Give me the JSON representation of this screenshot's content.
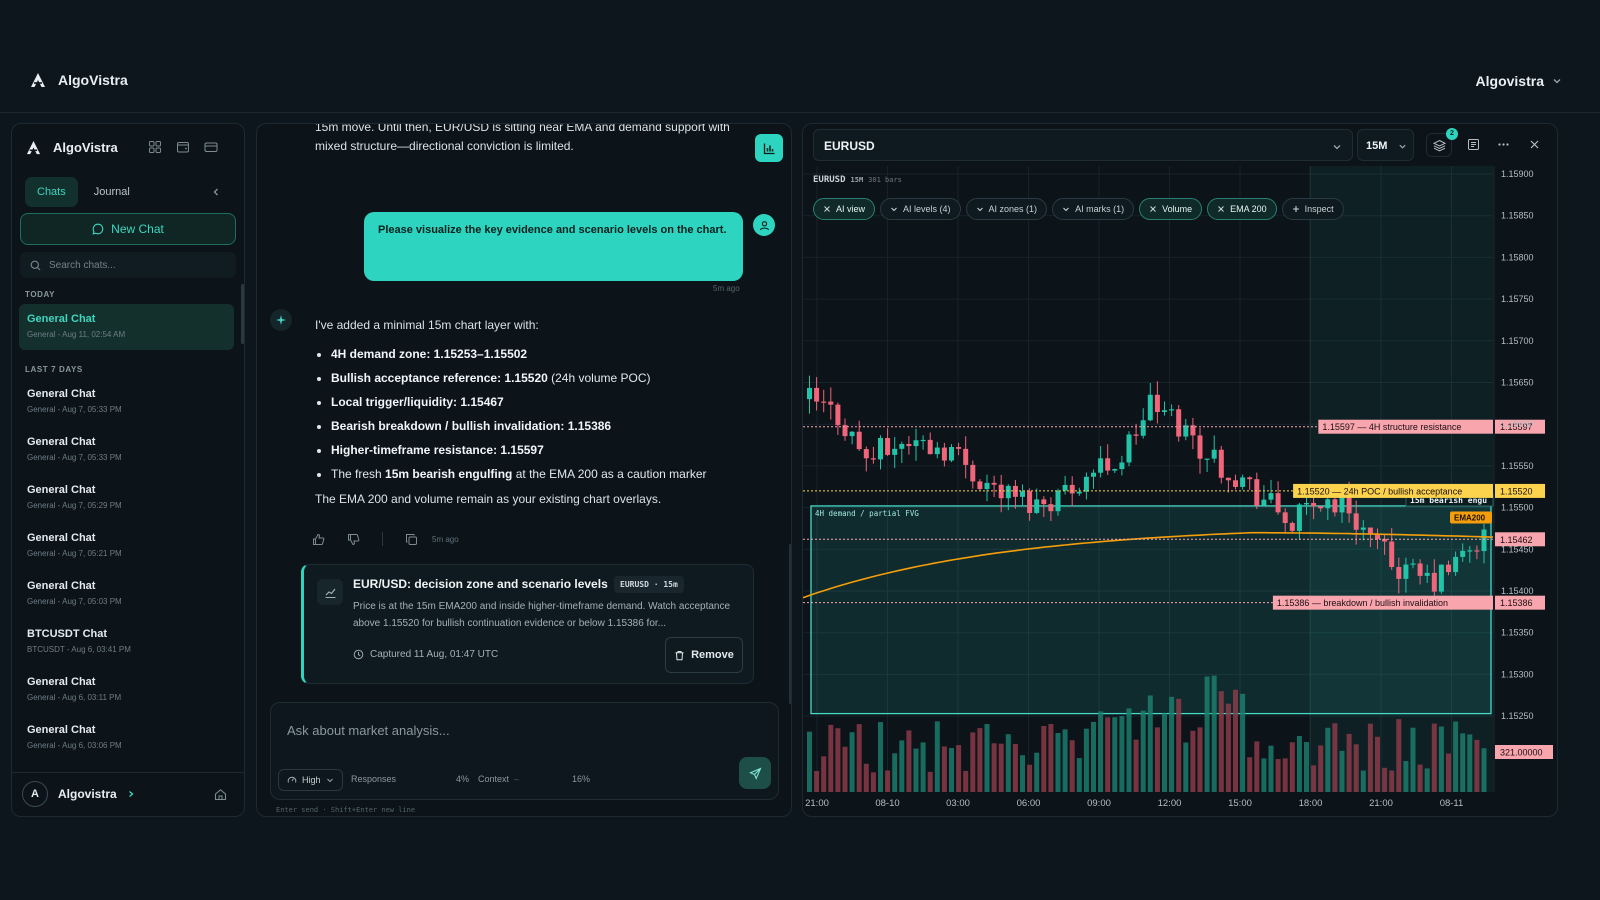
{
  "app": {
    "name": "AlgoVistra",
    "user_menu": "Algovistra"
  },
  "sidebar": {
    "brand": "AlgoVistra",
    "tabs": [
      {
        "label": "Chats"
      },
      {
        "label": "Journal"
      }
    ],
    "new_chat_label": "New Chat",
    "search_placeholder": "Search chats...",
    "today_label": "TODAY",
    "last7_label": "LAST 7 DAYS",
    "today_items": [
      {
        "title": "General Chat",
        "subtitle": "General - Aug 11, 02:54 AM"
      }
    ],
    "items": [
      {
        "title": "General Chat",
        "subtitle": "General - Aug 7, 05:33 PM"
      },
      {
        "title": "General Chat",
        "subtitle": "General - Aug 7, 05:33 PM"
      },
      {
        "title": "General Chat",
        "subtitle": "General - Aug 7, 05:29 PM"
      },
      {
        "title": "General Chat",
        "subtitle": "General - Aug 7, 05:21 PM"
      },
      {
        "title": "General Chat",
        "subtitle": "General - Aug 7, 05:03 PM"
      },
      {
        "title": "BTCUSDT Chat",
        "subtitle": "BTCUSDT - Aug 6, 03:41 PM"
      },
      {
        "title": "General Chat",
        "subtitle": "General - Aug 6, 03:11 PM"
      },
      {
        "title": "General Chat",
        "subtitle": "General - Aug 6, 03:06 PM"
      }
    ],
    "footer": {
      "avatar": "A",
      "name": "Algovistra"
    }
  },
  "conversation": {
    "prev_message": "15m move. Until then, EUR/USD is sitting near EMA and demand support with mixed structure—directional conviction is limited.",
    "user_message": "Please visualize the key evidence and scenario levels on the chart.",
    "user_time": "5m ago",
    "ai_intro": "I've added a minimal 15m chart layer with:",
    "bullets": [
      {
        "bold": "4H demand zone: 1.15253–1.15502",
        "rest": ""
      },
      {
        "bold": "Bullish acceptance reference: 1.15520",
        "rest": " (24h volume POC)"
      },
      {
        "bold": "Local trigger/liquidity: 1.15467",
        "rest": ""
      },
      {
        "bold": "Bearish breakdown / bullish invalidation: 1.15386",
        "rest": ""
      },
      {
        "bold": "Higher-timeframe resistance: 1.15597",
        "rest": ""
      }
    ],
    "last_bullet": {
      "pre": "The fresh ",
      "bold": "15m bearish engulfing",
      "post": " at the EMA 200 as a caution marker"
    },
    "outro": "The EMA 200 and volume remain as your existing chart overlays.",
    "ai_time": "5m ago",
    "card": {
      "title": "EUR/USD: decision zone and scenario levels",
      "badge": "EURUSD · 15m",
      "body": "Price is at the 15m EMA200 and inside higher-timeframe demand. Watch acceptance above 1.15520 for bullish continuation evidence or below 1.15386 for...",
      "captured": "Captured 11 Aug, 01:47 UTC",
      "remove_label": "Remove"
    }
  },
  "composer": {
    "placeholder": "Ask about market analysis...",
    "effort": "High",
    "responses_label": "Responses",
    "responses_pct": "4%",
    "context_label": "Context",
    "context_pct": "16%",
    "hint": "Enter send · Shift+Enter new line"
  },
  "chart_pane": {
    "symbol": "EURUSD",
    "timeframe": "15M",
    "layers_badge": "2",
    "meta_symbol": "EURUSD",
    "meta_tf": "15M",
    "meta_bars": "301 bars",
    "chips": [
      {
        "label": "AI view",
        "state": "on",
        "icon": "x"
      },
      {
        "label": "AI levels (4)",
        "state": "off",
        "icon": "v"
      },
      {
        "label": "AI zones (1)",
        "state": "off",
        "icon": "v"
      },
      {
        "label": "AI marks (1)",
        "state": "off",
        "icon": "v"
      },
      {
        "label": "Volume",
        "state": "on",
        "icon": "x"
      },
      {
        "label": "EMA 200",
        "state": "on",
        "icon": "x"
      },
      {
        "label": "Inspect",
        "state": "off",
        "icon": "+"
      }
    ],
    "zone_label": "4H demand / partial FVG",
    "engulf_label": "15m bearish engu",
    "ema_label": "EMA200",
    "volume_axis_label": "321.00000"
  },
  "chart_data": {
    "type": "candlestick",
    "symbol": "EURUSD",
    "timeframe": "15M",
    "y_ticks": [
      "1.15900",
      "1.15850",
      "1.15800",
      "1.15750",
      "1.15700",
      "1.15650",
      "1.15600",
      "1.15550",
      "1.15500",
      "1.15450",
      "1.15400",
      "1.15350",
      "1.15300",
      "1.15250"
    ],
    "x_ticks": [
      "21:00",
      "08-10",
      "03:00",
      "06:00",
      "09:00",
      "12:00",
      "15:00",
      "18:00",
      "21:00",
      "08-11"
    ],
    "ylim": [
      1.15225,
      1.15905
    ],
    "zone": {
      "label": "4H demand / partial FVG",
      "low": 1.15253,
      "high": 1.15502
    },
    "levels": [
      {
        "price": 1.15597,
        "label": "1.15597 — 4H structure resistance",
        "axis": "1.15597",
        "color": "#f8a5ad"
      },
      {
        "price": 1.1552,
        "label": "1.15520 — 24h POC / bullish acceptance",
        "axis": "1.15520",
        "color": "#fcd34d"
      },
      {
        "price": 1.15462,
        "label": "",
        "axis": "1.15462",
        "color": "#f8a5ad"
      },
      {
        "price": 1.15386,
        "label": "1.15386 — breakdown / bullish invalidation",
        "axis": "1.15386",
        "color": "#f8a5ad"
      }
    ],
    "candle_count": 96,
    "ema200_note": "EMA 200 rises from ~1.1539 to ~1.1548 and flattens"
  }
}
